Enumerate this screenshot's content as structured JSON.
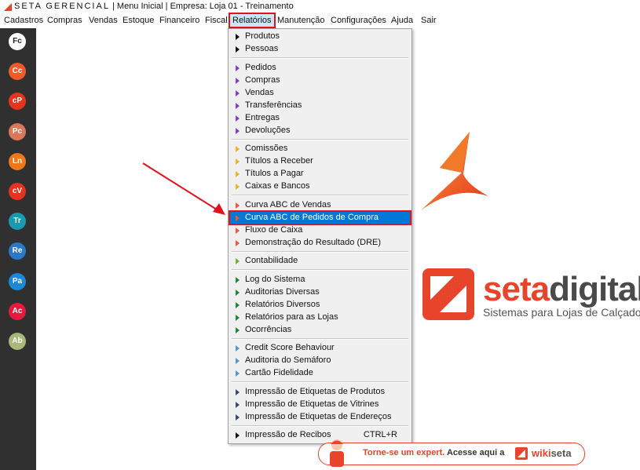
{
  "window": {
    "brand": "SETA GERENCIAL",
    "title_rest": " | Menu Inicial | Empresa: Loja 01 - Treinamento"
  },
  "menubar": [
    {
      "label": "Cadastros"
    },
    {
      "label": "Compras"
    },
    {
      "label": "Vendas"
    },
    {
      "label": "Estoque"
    },
    {
      "label": "Financeiro"
    },
    {
      "label": "Fiscal"
    },
    {
      "label": "Relatórios",
      "active": true
    },
    {
      "label": "Manutenção"
    },
    {
      "label": "Configurações"
    },
    {
      "label": "Ajuda"
    },
    {
      "label": "Sair"
    }
  ],
  "sidebar": [
    {
      "label": "Fc",
      "color": "#ffffff",
      "text_color": "#222222"
    },
    {
      "label": "Cc",
      "color": "#f05a28"
    },
    {
      "label": "cP",
      "color": "#e8321e"
    },
    {
      "label": "Pc",
      "color": "#d9785a"
    },
    {
      "label": "Ln",
      "color": "#f07818"
    },
    {
      "label": "cV",
      "color": "#e8321e"
    },
    {
      "label": "Tr",
      "color": "#1a9ab0"
    },
    {
      "label": "Re",
      "color": "#2a78c8"
    },
    {
      "label": "Pa",
      "color": "#1a8ad8"
    },
    {
      "label": "Ac",
      "color": "#e8193c"
    },
    {
      "label": "Ab",
      "color": "#a8b878"
    }
  ],
  "dropdown": {
    "groups": [
      {
        "color": "#111111",
        "items": [
          {
            "label": "Produtos"
          },
          {
            "label": "Pessoas"
          }
        ]
      },
      {
        "color": "#8a3ad0",
        "items": [
          {
            "label": "Pedidos"
          },
          {
            "label": "Compras"
          },
          {
            "label": "Vendas"
          },
          {
            "label": "Transferências"
          },
          {
            "label": "Entregas"
          },
          {
            "label": "Devoluções"
          }
        ]
      },
      {
        "color": "#f0b020",
        "items": [
          {
            "label": "Comissões"
          },
          {
            "label": "Títulos a Receber"
          },
          {
            "label": "Títulos a Pagar"
          },
          {
            "label": "Caixas e Bancos"
          }
        ]
      },
      {
        "color": "#f05a28",
        "items": [
          {
            "label": "Curva ABC de Vendas"
          },
          {
            "label": "Curva ABC de Pedidos de Compra",
            "highlighted": true
          },
          {
            "label": "Fluxo de Caixa"
          },
          {
            "label": "Demonstração do Resultado (DRE)"
          }
        ]
      },
      {
        "color": "#78b030",
        "items": [
          {
            "label": "Contabilidade"
          }
        ]
      },
      {
        "color": "#1a8a30",
        "items": [
          {
            "label": "Log do Sistema"
          },
          {
            "label": "Auditorias Diversas"
          },
          {
            "label": "Relatórios Diversos"
          },
          {
            "label": "Relatórios para as Lojas"
          },
          {
            "label": "Ocorrências"
          }
        ]
      },
      {
        "color": "#4a9ad8",
        "items": [
          {
            "label": "Credit Score Behaviour"
          },
          {
            "label": "Auditoria do Semáforo"
          },
          {
            "label": "Cartão Fidelidade"
          }
        ]
      },
      {
        "color": "#3a4a6a",
        "items": [
          {
            "label": "Impressão de Etiquetas de Produtos"
          },
          {
            "label": "Impressão de Etiquetas de Vitrines"
          },
          {
            "label": "Impressão de Etiquetas de Endereços"
          }
        ]
      },
      {
        "color": "#111111",
        "items": [
          {
            "label": "Impressão de Recibos",
            "shortcut": "CTRL+R"
          }
        ]
      }
    ]
  },
  "brand": {
    "name_part1": "seta",
    "name_part2": "digital",
    "tagline": "Sistemas para Lojas de Calçados",
    "primary_color": "#e8442b"
  },
  "banner": {
    "text": "Torne-se um expert.",
    "cta": "Acesse aqui a",
    "wiki_part1": "wiki",
    "wiki_part2": "seta"
  }
}
